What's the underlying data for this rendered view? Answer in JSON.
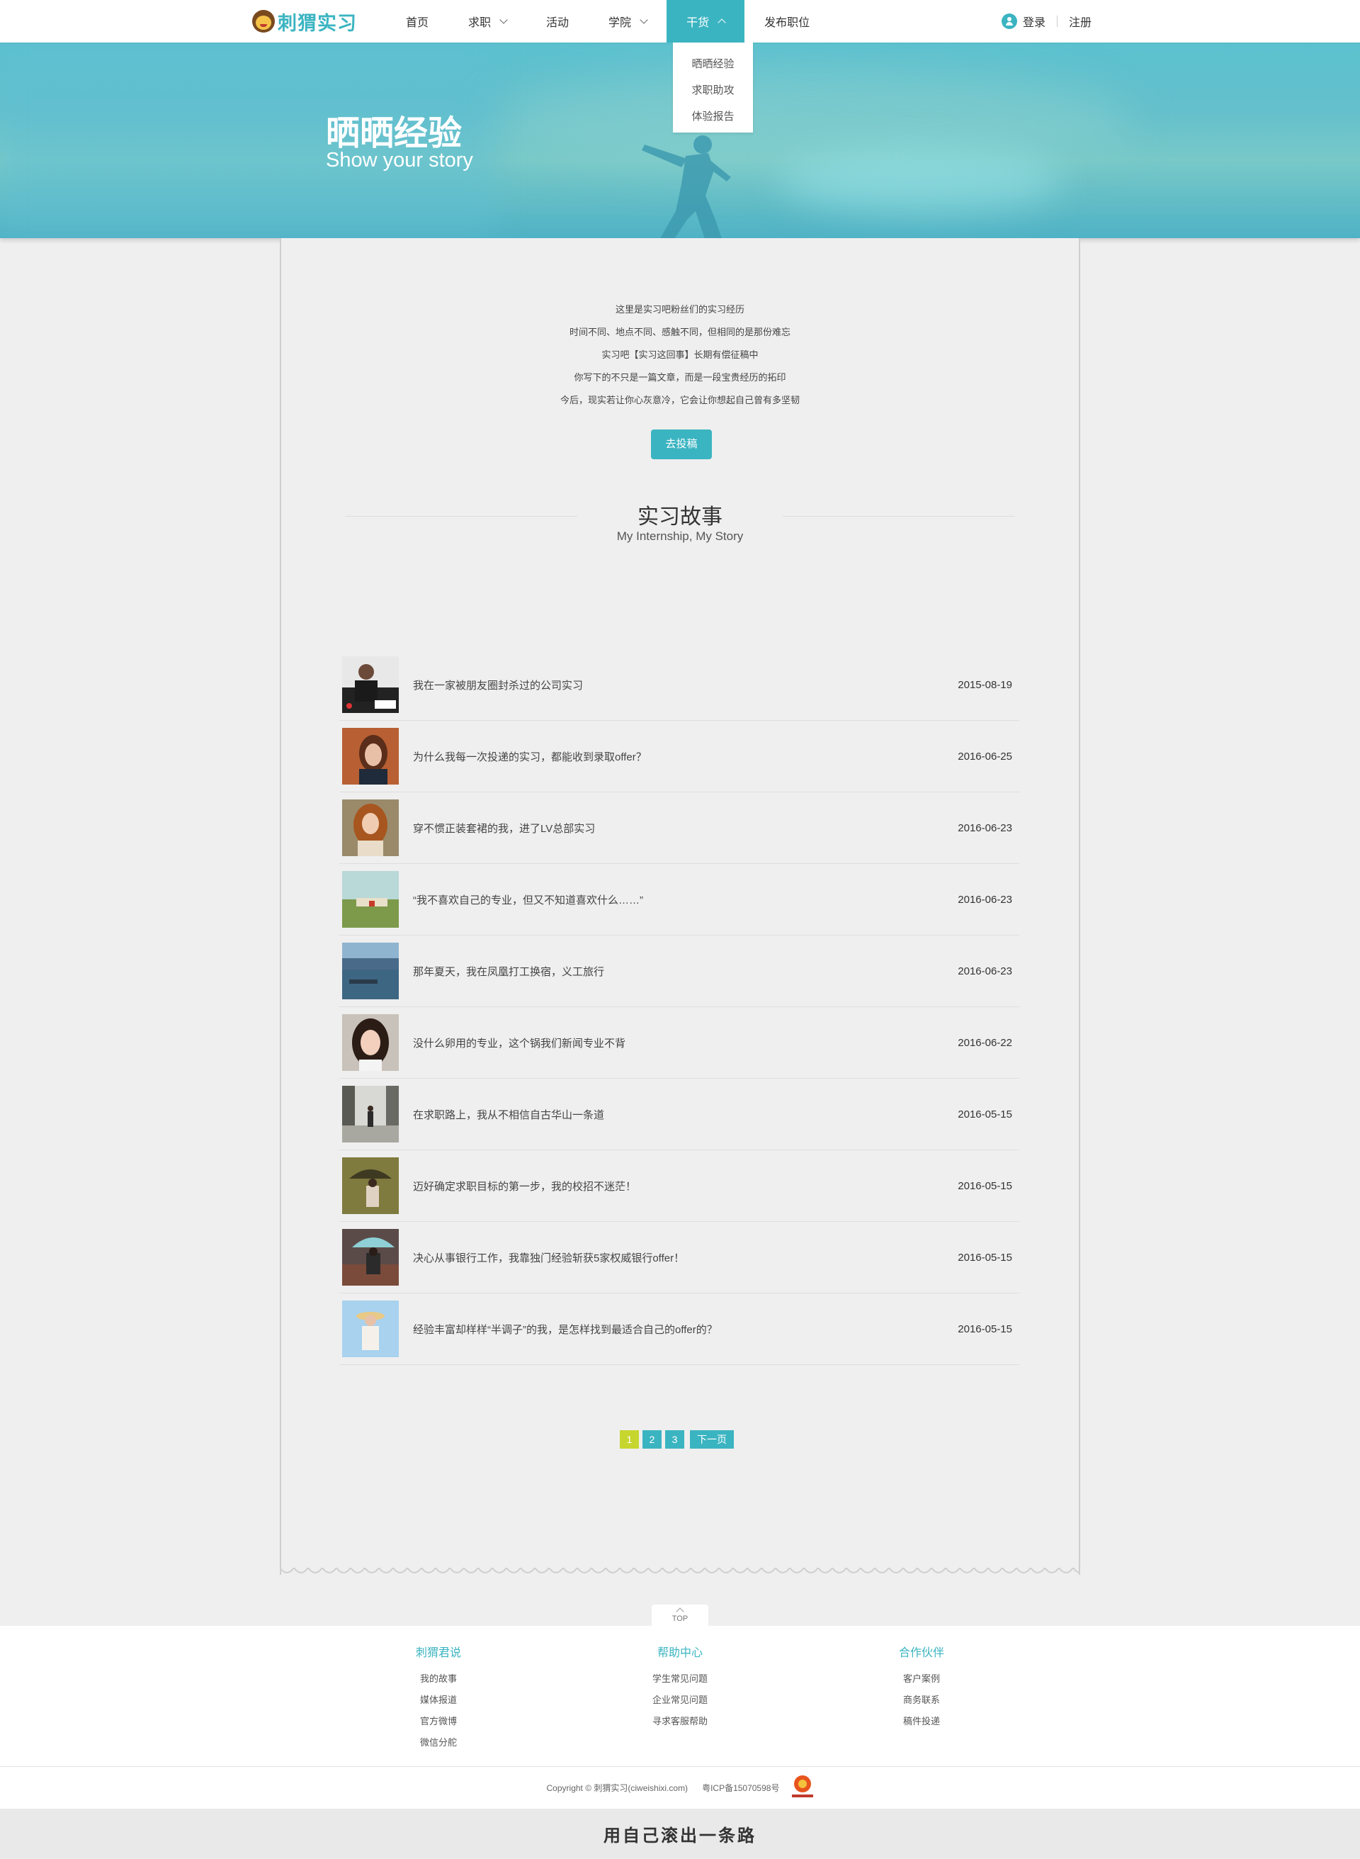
{
  "header": {
    "logo_text": "刺猬实习",
    "nav": [
      {
        "label": "首页",
        "has_dropdown": false,
        "active": false
      },
      {
        "label": "求职",
        "has_dropdown": true,
        "active": false
      },
      {
        "label": "活动",
        "has_dropdown": false,
        "active": false
      },
      {
        "label": "学院",
        "has_dropdown": true,
        "active": false
      },
      {
        "label": "干货",
        "has_dropdown": true,
        "active": true
      },
      {
        "label": "发布职位",
        "has_dropdown": false,
        "active": false
      }
    ],
    "login": "登录",
    "register": "注册",
    "dropdown": [
      "晒晒经验",
      "求职助攻",
      "体验报告"
    ]
  },
  "banner": {
    "title": "晒晒经验",
    "subtitle": "Show your story"
  },
  "intro": {
    "lines": [
      "这里是实习吧粉丝们的实习经历",
      "时间不同、地点不同、感触不同，但相同的是那份难忘",
      "实习吧【实习这回事】长期有偿征稿中",
      "你写下的不只是一篇文章，而是一段宝贵经历的拓印",
      "今后，现实若让你心灰意冷，它会让你想起自己曾有多坚韧"
    ],
    "button": "去投稿"
  },
  "section": {
    "title": "实习故事",
    "subtitle": "My Internship, My Story"
  },
  "stories": [
    {
      "title": "我在一家被朋友圈封杀过的公司实习",
      "date": "2015-08-19",
      "thumb": "uber-man"
    },
    {
      "title": "为什么我每一次投递的实习，都能收到录取offer？",
      "date": "2016-06-25",
      "thumb": "woman-brick"
    },
    {
      "title": "穿不惯正装套裙的我，进了LV总部实习",
      "date": "2016-06-23",
      "thumb": "woman-curly"
    },
    {
      "title": "“我不喜欢自己的专业，但又不知道喜欢什么……”",
      "date": "2016-06-23",
      "thumb": "field-car"
    },
    {
      "title": "那年夏天，我在凤凰打工换宿，义工旅行",
      "date": "2016-06-23",
      "thumb": "river-boat"
    },
    {
      "title": "没什么卵用的专业，这个锅我们新闻专业不背",
      "date": "2016-06-22",
      "thumb": "woman-portrait"
    },
    {
      "title": "在求职路上，我从不相信自古华山一条道",
      "date": "2016-05-15",
      "thumb": "street-walk"
    },
    {
      "title": "迈好确定求职目标的第一步，我的校招不迷茫！",
      "date": "2016-05-15",
      "thumb": "umbrella-girl"
    },
    {
      "title": "决心从事银行工作，我靠独门经验斩获5家权威银行offer！",
      "date": "2016-05-15",
      "thumb": "umbrella-rain"
    },
    {
      "title": "经验丰富却样样“半调子”的我，是怎样找到最适合自己的offer的？",
      "date": "2016-05-15",
      "thumb": "hat-girl"
    }
  ],
  "pagination": {
    "pages": [
      "1",
      "2",
      "3"
    ],
    "current": "1",
    "next": "下一页"
  },
  "footer": {
    "top_label": "TOP",
    "columns": [
      {
        "title": "刺猬君说",
        "links": [
          "我的故事",
          "媒体报道",
          "官方微博",
          "微信分舵"
        ]
      },
      {
        "title": "帮助中心",
        "links": [
          "学生常见问题",
          "企业常见问题",
          "寻求客服帮助"
        ]
      },
      {
        "title": "合作伙伴",
        "links": [
          "客户案例",
          "商务联系",
          "稿件投递"
        ]
      }
    ],
    "copyright": "Copyright © 刺猬实习(ciweishixi.com)",
    "icp": "粤ICP备15070598号",
    "slogan": "用自己滚出一条路"
  },
  "colors": {
    "accent": "#3bb4c1",
    "current_page": "#c6d62f"
  }
}
